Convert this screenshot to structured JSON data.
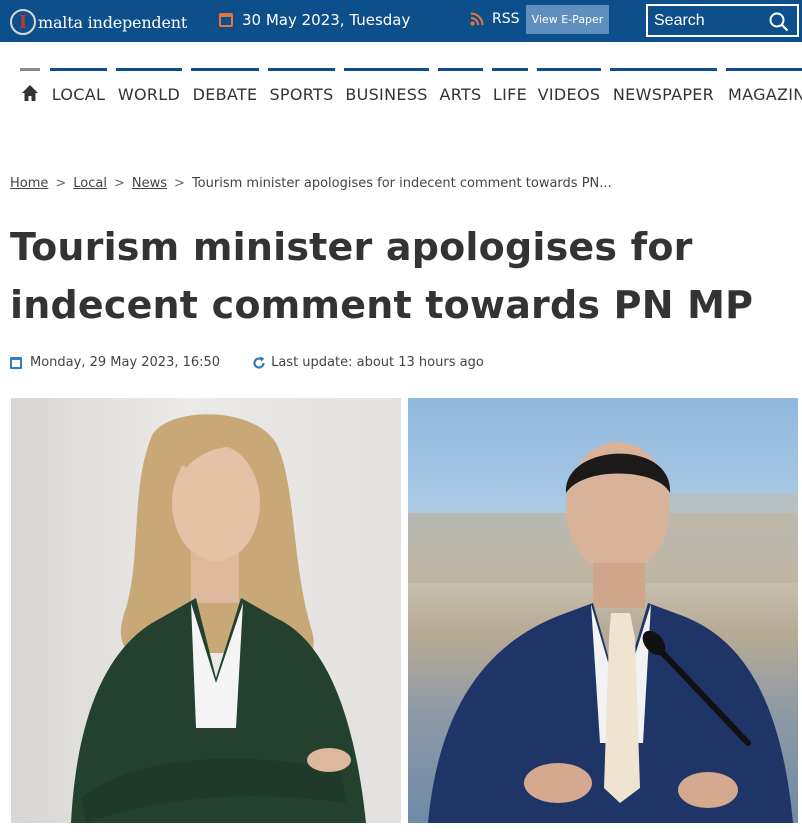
{
  "header": {
    "logo_letter": "I",
    "logo_text": "malta independent",
    "date": "30 May 2023, Tuesday",
    "rss_label": "RSS",
    "epaper_label": "View E-Paper",
    "search_placeholder": "Search"
  },
  "nav": {
    "items": [
      "LOCAL",
      "WORLD",
      "DEBATE",
      "SPORTS",
      "BUSINESS",
      "ARTS",
      "LIFE",
      "VIDEOS",
      "NEWSPAPER",
      "MAGAZIN"
    ]
  },
  "breadcrumb": {
    "home": "Home",
    "local": "Local",
    "news": "News",
    "separator": ">",
    "current": "Tourism minister apologises for indecent comment towards PN..."
  },
  "article": {
    "title_line1": "Tourism minister apologises for",
    "title_line2": "indecent comment towards PN MP",
    "published": "Monday, 29 May 2023, 16:50",
    "last_update": "Last update: about 13 hours ago"
  },
  "colors": {
    "brand_blue": "#0d4f8b",
    "accent_orange": "#e8743b",
    "epaper_bg": "#5f8fbf",
    "text_dark": "#333333"
  },
  "icons": [
    "home-icon",
    "calendar-icon",
    "rss-icon",
    "search-icon",
    "refresh-icon"
  ]
}
